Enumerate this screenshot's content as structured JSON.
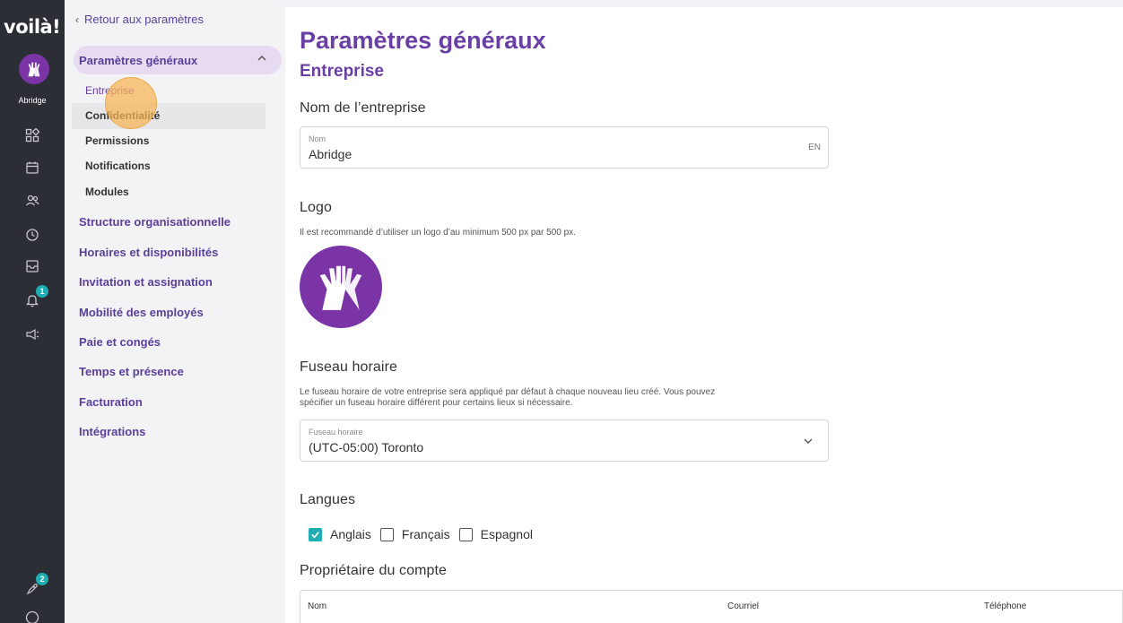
{
  "rail": {
    "logo": "voilà!",
    "company_name": "Abridge",
    "icons": [
      "dashboard-icon",
      "calendar-icon",
      "people-icon",
      "clock-icon",
      "inbox-icon",
      "bell-icon",
      "megaphone-icon",
      "rocket-icon",
      "help-icon"
    ],
    "notification_badge": "1",
    "rocket_badge": "2",
    "accent": "#1faeb4"
  },
  "menu": {
    "back_label": "Retour aux paramètres",
    "active_group": "Paramètres généraux",
    "subitems": [
      "Entreprise",
      "Confidentialité",
      "Permissions",
      "Notifications",
      "Modules"
    ],
    "groups": [
      "Structure organisationnelle",
      "Horaires et disponibilités",
      "Invitation et assignation",
      "Mobilité des employés",
      "Paie et congés",
      "Temps et présence",
      "Facturation",
      "Intégrations"
    ],
    "brand_color": "#6a3fa5"
  },
  "main": {
    "title": "Paramètres généraux",
    "subtitle": "Entreprise",
    "company_section": "Nom de l’entreprise",
    "name_label": "Nom",
    "name_value": "Abridge",
    "lang_code": "EN",
    "logo_section": "Logo",
    "logo_help": "Il est recommandé d’utiliser un logo d’au minimum 500 px par 500 px.",
    "tz_section": "Fuseau horaire",
    "tz_help_1": "Le fuseau horaire de votre entreprise sera appliqué par défaut à chaque nouveau lieu créé. Vous pouvez",
    "tz_help_2": "spécifier un fuseau horaire différent pour certains lieux si nécessaire.",
    "tz_label": "Fuseau horaire",
    "tz_value": "(UTC-05:00) Toronto",
    "lang_section": "Langues",
    "languages": [
      {
        "label": "Anglais",
        "checked": true
      },
      {
        "label": "Français",
        "checked": false
      },
      {
        "label": "Espagnol",
        "checked": false
      }
    ],
    "owner_section": "Propriétaire du compte",
    "table_headers": [
      "Nom",
      "Courriel",
      "Téléphone"
    ]
  }
}
